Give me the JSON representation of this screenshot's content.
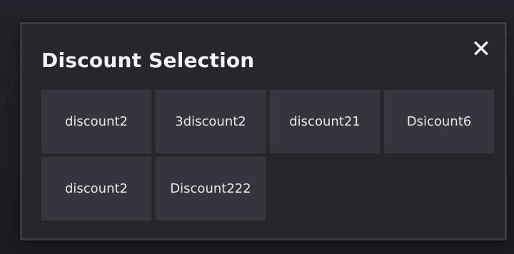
{
  "modal": {
    "title": "Discount Selection",
    "close_icon": "close-icon",
    "close_glyph": "✕",
    "options": [
      {
        "label": "discount2"
      },
      {
        "label": "3discount2"
      },
      {
        "label": "discount21"
      },
      {
        "label": "Dsicount6"
      },
      {
        "label": "discount2"
      },
      {
        "label": "Discount222"
      }
    ]
  }
}
